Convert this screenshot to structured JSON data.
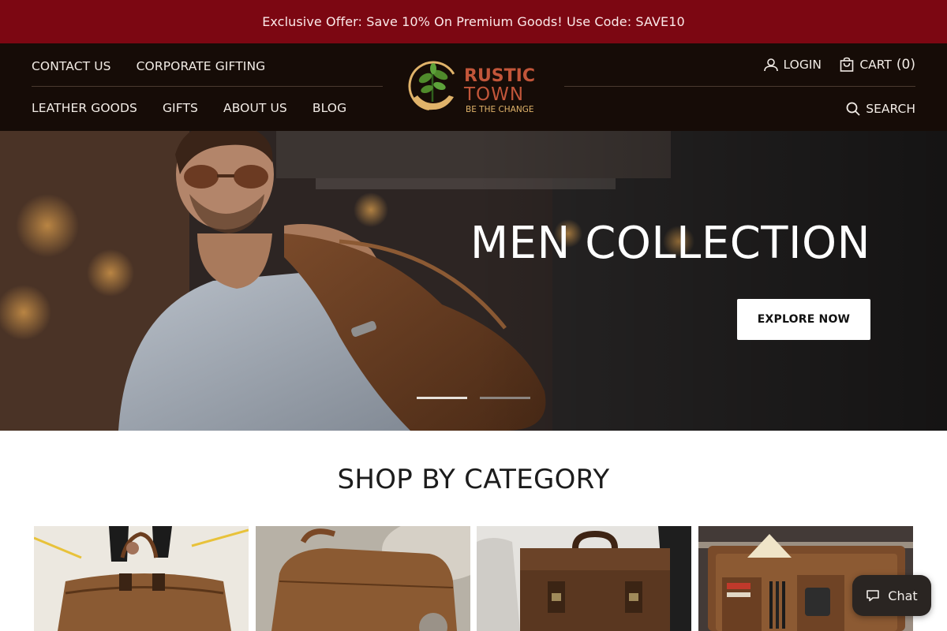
{
  "announcement": "Exclusive Offer: Save 10% On Premium Goods! Use Code: SAVE10",
  "nav": {
    "top_links": [
      "CONTACT US",
      "CORPORATE GIFTING"
    ],
    "main_links": [
      "LEATHER GOODS",
      "GIFTS",
      "ABOUT US",
      "BLOG"
    ]
  },
  "logo": {
    "line1": "RUSTIC",
    "line2": "TOWN",
    "tagline": "BE THE CHANGE"
  },
  "utility": {
    "login": "LOGIN",
    "cart": "CART",
    "cart_count": "(0)",
    "search": "SEARCH"
  },
  "hero": {
    "title": "MEN COLLECTION",
    "cta": "EXPLORE NOW",
    "slides": 2,
    "active_slide": 1
  },
  "category_section": {
    "title": "SHOP BY CATEGORY"
  },
  "categories": [
    {
      "icon": "duffel-bag-image"
    },
    {
      "icon": "toiletry-bag-image"
    },
    {
      "icon": "briefcase-image"
    },
    {
      "icon": "portfolio-organizer-image"
    }
  ],
  "chat": {
    "label": "Chat"
  },
  "colors": {
    "announcement_bg": "#7c0712",
    "header_bg": "#160c07",
    "logo_brand": "#c2563a",
    "logo_green": "#4f8a2b",
    "logo_hand": "#e0b36a"
  }
}
